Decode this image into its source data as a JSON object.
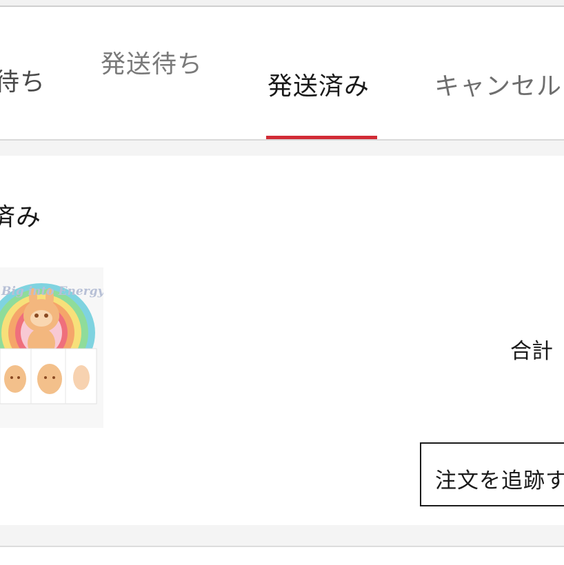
{
  "tabs": [
    {
      "label": "待ち"
    },
    {
      "label": "発送待ち"
    },
    {
      "label": "発送済み",
      "active": true
    },
    {
      "label": "キャンセル"
    }
  ],
  "accent_color": "#d12b35",
  "order": {
    "status": "済み",
    "product_image_text": "Big into Energy",
    "total_label": "合計",
    "track_button_label": "注文を追跡す"
  }
}
